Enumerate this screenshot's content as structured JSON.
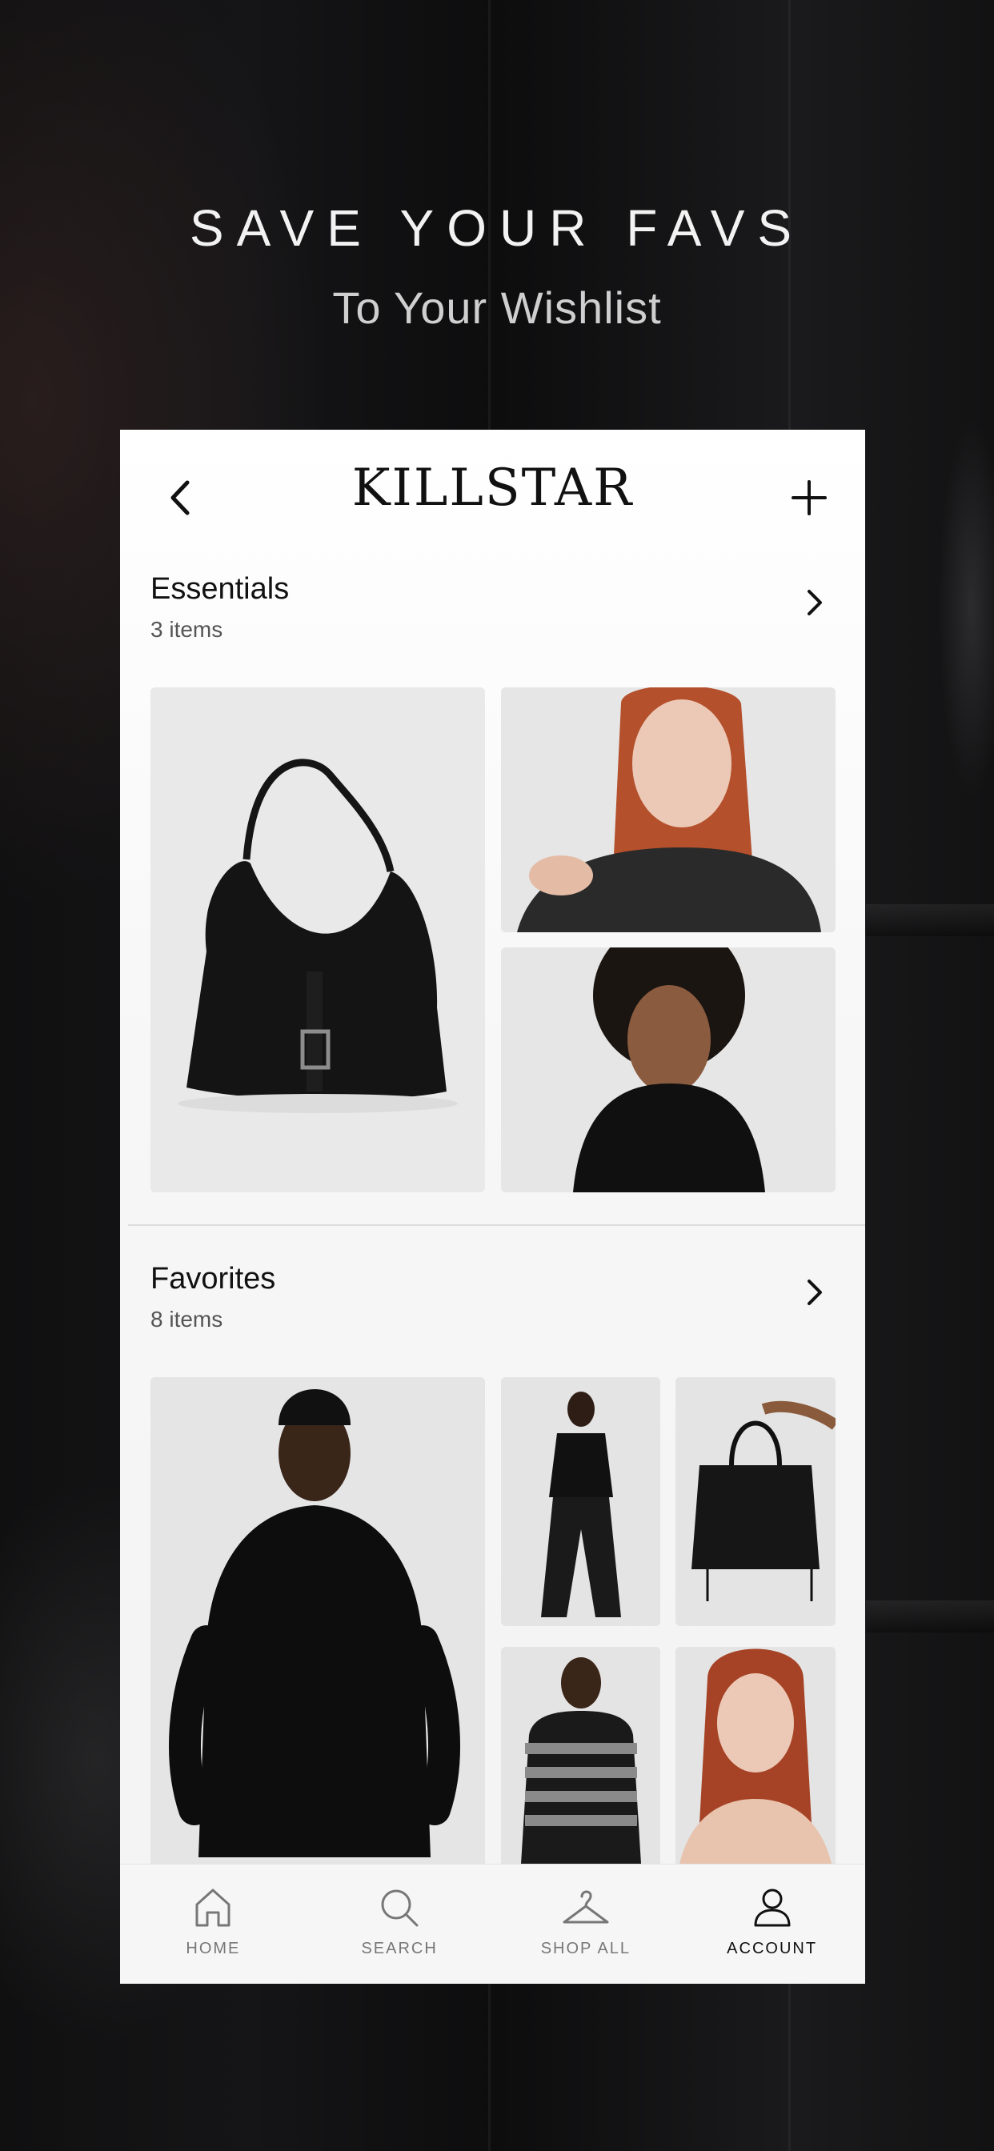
{
  "headline": "SAVE YOUR FAVS",
  "subheadline": "To Your Wishlist",
  "app": {
    "logo_text": "KILLSTAR"
  },
  "collections": [
    {
      "title": "Essentials",
      "count": "3 items"
    },
    {
      "title": "Favorites",
      "count": "8 items"
    }
  ],
  "essentials_images": [
    {
      "alt": "Black suede hobo bag with silver buckle"
    },
    {
      "alt": "Red-haired model in dark knit sweater"
    },
    {
      "alt": "Model in black collared blouse"
    }
  ],
  "favorites_images": [
    {
      "alt": "Model in long black chiffon-sleeve dress"
    },
    {
      "alt": "Model in black knit top and flared trousers"
    },
    {
      "alt": "Hand holding black tote bag"
    },
    {
      "alt": "Model in black and grey striped sweater"
    },
    {
      "alt": "Red-haired model with earrings"
    }
  ],
  "tabbar": {
    "tabs": [
      {
        "label": "HOME",
        "icon": "home-icon"
      },
      {
        "label": "SEARCH",
        "icon": "search-icon"
      },
      {
        "label": "SHOP ALL",
        "icon": "hanger-icon"
      },
      {
        "label": "ACCOUNT",
        "icon": "user-icon"
      }
    ],
    "active": "ACCOUNT"
  },
  "colors": {
    "background": "#0b0b0c",
    "screen": "#ffffff",
    "text": "#111111",
    "muted": "#555555"
  }
}
